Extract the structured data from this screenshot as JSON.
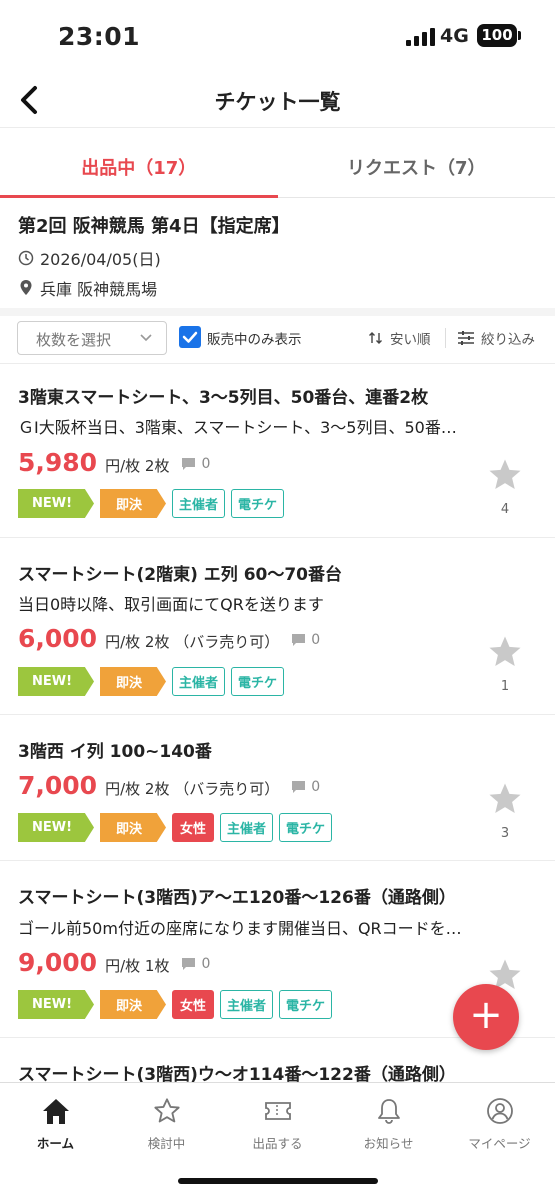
{
  "status": {
    "time": "23:01",
    "network": "4G",
    "battery": "100"
  },
  "nav": {
    "title": "チケット一覧"
  },
  "tabs": [
    {
      "label": "出品中（17）",
      "active": true
    },
    {
      "label": "リクエスト（7）",
      "active": false
    }
  ],
  "event": {
    "title": "第2回 阪神競馬 第4日【指定席】",
    "date": "2026/04/05(日)",
    "venue": "兵庫 阪神競馬場"
  },
  "filters": {
    "count_placeholder": "枚数を選択",
    "on_sale_only": "販売中のみ表示",
    "sort": "安い順",
    "refine": "絞り込み"
  },
  "listings": [
    {
      "title": "3階東スマートシート、3〜5列目、50番台、連番2枚",
      "desc": "ＧⅠ大阪杯当日、3階東、スマートシート、3〜5列目、50番…",
      "price": "5,980",
      "unit": "円/枚 2枚",
      "comments": "0",
      "tags": [
        "NEW!",
        "即決",
        "主催者",
        "電チケ"
      ],
      "favorites": "4"
    },
    {
      "title": "スマートシート(2階東) エ列 60〜70番台",
      "desc": "当日0時以降、取引画面にてQRを送ります",
      "price": "6,000",
      "unit": "円/枚 2枚 （バラ売り可）",
      "comments": "0",
      "tags": [
        "NEW!",
        "即決",
        "主催者",
        "電チケ"
      ],
      "favorites": "1"
    },
    {
      "title": "3階西 イ列 100~140番",
      "desc": "",
      "price": "7,000",
      "unit": "円/枚 2枚 （バラ売り可）",
      "comments": "0",
      "tags": [
        "NEW!",
        "即決",
        "女性",
        "主催者",
        "電チケ"
      ],
      "favorites": "3"
    },
    {
      "title": "スマートシート(3階西)ア〜エ120番〜126番（通路側）",
      "desc": "ゴール前50m付近の座席になります開催当日、QRコードを…",
      "price": "9,000",
      "unit": "円/枚 1枚",
      "comments": "0",
      "tags": [
        "NEW!",
        "即決",
        "女性",
        "主催者",
        "電チケ"
      ],
      "favorites": ""
    },
    {
      "title": "スマートシート(3階西)ウ〜オ114番〜122番（通路側）"
    }
  ],
  "fab": {
    "label": "+"
  },
  "bottom_nav": [
    {
      "label": "ホーム",
      "icon": "home-icon",
      "active": true
    },
    {
      "label": "検討中",
      "icon": "star-icon",
      "active": false
    },
    {
      "label": "出品する",
      "icon": "ticket-icon",
      "active": false
    },
    {
      "label": "お知らせ",
      "icon": "bell-icon",
      "active": false
    },
    {
      "label": "マイページ",
      "icon": "user-icon",
      "active": false
    }
  ],
  "colors": {
    "accent": "#e8484f",
    "new": "#9cc63e",
    "sokketsu": "#f0a23a",
    "outline_tag": "#2bb5a5",
    "checkbox": "#1a73e8"
  }
}
